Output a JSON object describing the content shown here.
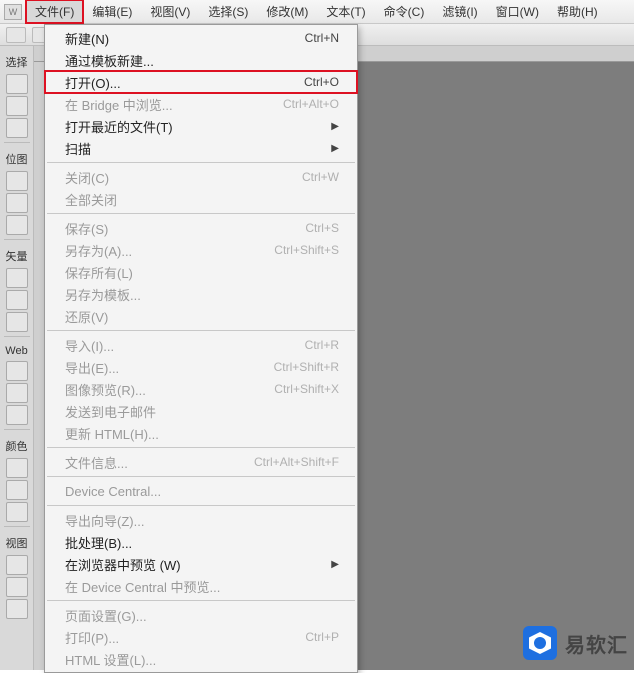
{
  "menubar": {
    "logo": "W",
    "items": [
      {
        "label": "文件(F)",
        "highlighted": true
      },
      {
        "label": "编辑(E)"
      },
      {
        "label": "视图(V)"
      },
      {
        "label": "选择(S)"
      },
      {
        "label": "修改(M)"
      },
      {
        "label": "文本(T)"
      },
      {
        "label": "命令(C)"
      },
      {
        "label": "滤镜(I)"
      },
      {
        "label": "窗口(W)"
      },
      {
        "label": "帮助(H)"
      }
    ]
  },
  "left_sections": [
    "选择",
    "位图",
    "矢量",
    "Web",
    "颜色",
    "视图"
  ],
  "dropdown": {
    "groups": [
      [
        {
          "label": "新建(N)",
          "shortcut": "Ctrl+N"
        },
        {
          "label": "通过模板新建..."
        },
        {
          "label": "打开(O)...",
          "shortcut": "Ctrl+O",
          "highlighted": true
        },
        {
          "label": "在 Bridge 中浏览...",
          "shortcut": "Ctrl+Alt+O",
          "disabled": true
        },
        {
          "label": "打开最近的文件(T)",
          "submenu": true
        },
        {
          "label": "扫描",
          "submenu": true
        }
      ],
      [
        {
          "label": "关闭(C)",
          "shortcut": "Ctrl+W",
          "disabled": true
        },
        {
          "label": "全部关闭",
          "disabled": true
        }
      ],
      [
        {
          "label": "保存(S)",
          "shortcut": "Ctrl+S",
          "disabled": true
        },
        {
          "label": "另存为(A)...",
          "shortcut": "Ctrl+Shift+S",
          "disabled": true
        },
        {
          "label": "保存所有(L)",
          "disabled": true
        },
        {
          "label": "另存为模板...",
          "disabled": true
        },
        {
          "label": "还原(V)",
          "disabled": true
        }
      ],
      [
        {
          "label": "导入(I)...",
          "shortcut": "Ctrl+R",
          "disabled": true
        },
        {
          "label": "导出(E)...",
          "shortcut": "Ctrl+Shift+R",
          "disabled": true
        },
        {
          "label": "图像预览(R)...",
          "shortcut": "Ctrl+Shift+X",
          "disabled": true
        },
        {
          "label": "发送到电子邮件",
          "disabled": true
        },
        {
          "label": "更新 HTML(H)...",
          "disabled": true
        }
      ],
      [
        {
          "label": "文件信息...",
          "shortcut": "Ctrl+Alt+Shift+F",
          "disabled": true
        }
      ],
      [
        {
          "label": "Device Central...",
          "disabled": true
        }
      ],
      [
        {
          "label": "导出向导(Z)...",
          "disabled": true
        },
        {
          "label": "批处理(B)..."
        },
        {
          "label": "在浏览器中预览 (W)",
          "submenu": true
        },
        {
          "label": "在 Device Central 中预览...",
          "disabled": true
        }
      ],
      [
        {
          "label": "页面设置(G)...",
          "disabled": true
        },
        {
          "label": "打印(P)...",
          "shortcut": "Ctrl+P",
          "disabled": true
        },
        {
          "label": "HTML 设置(L)...",
          "disabled": true
        }
      ]
    ]
  },
  "watermark": "易软汇"
}
